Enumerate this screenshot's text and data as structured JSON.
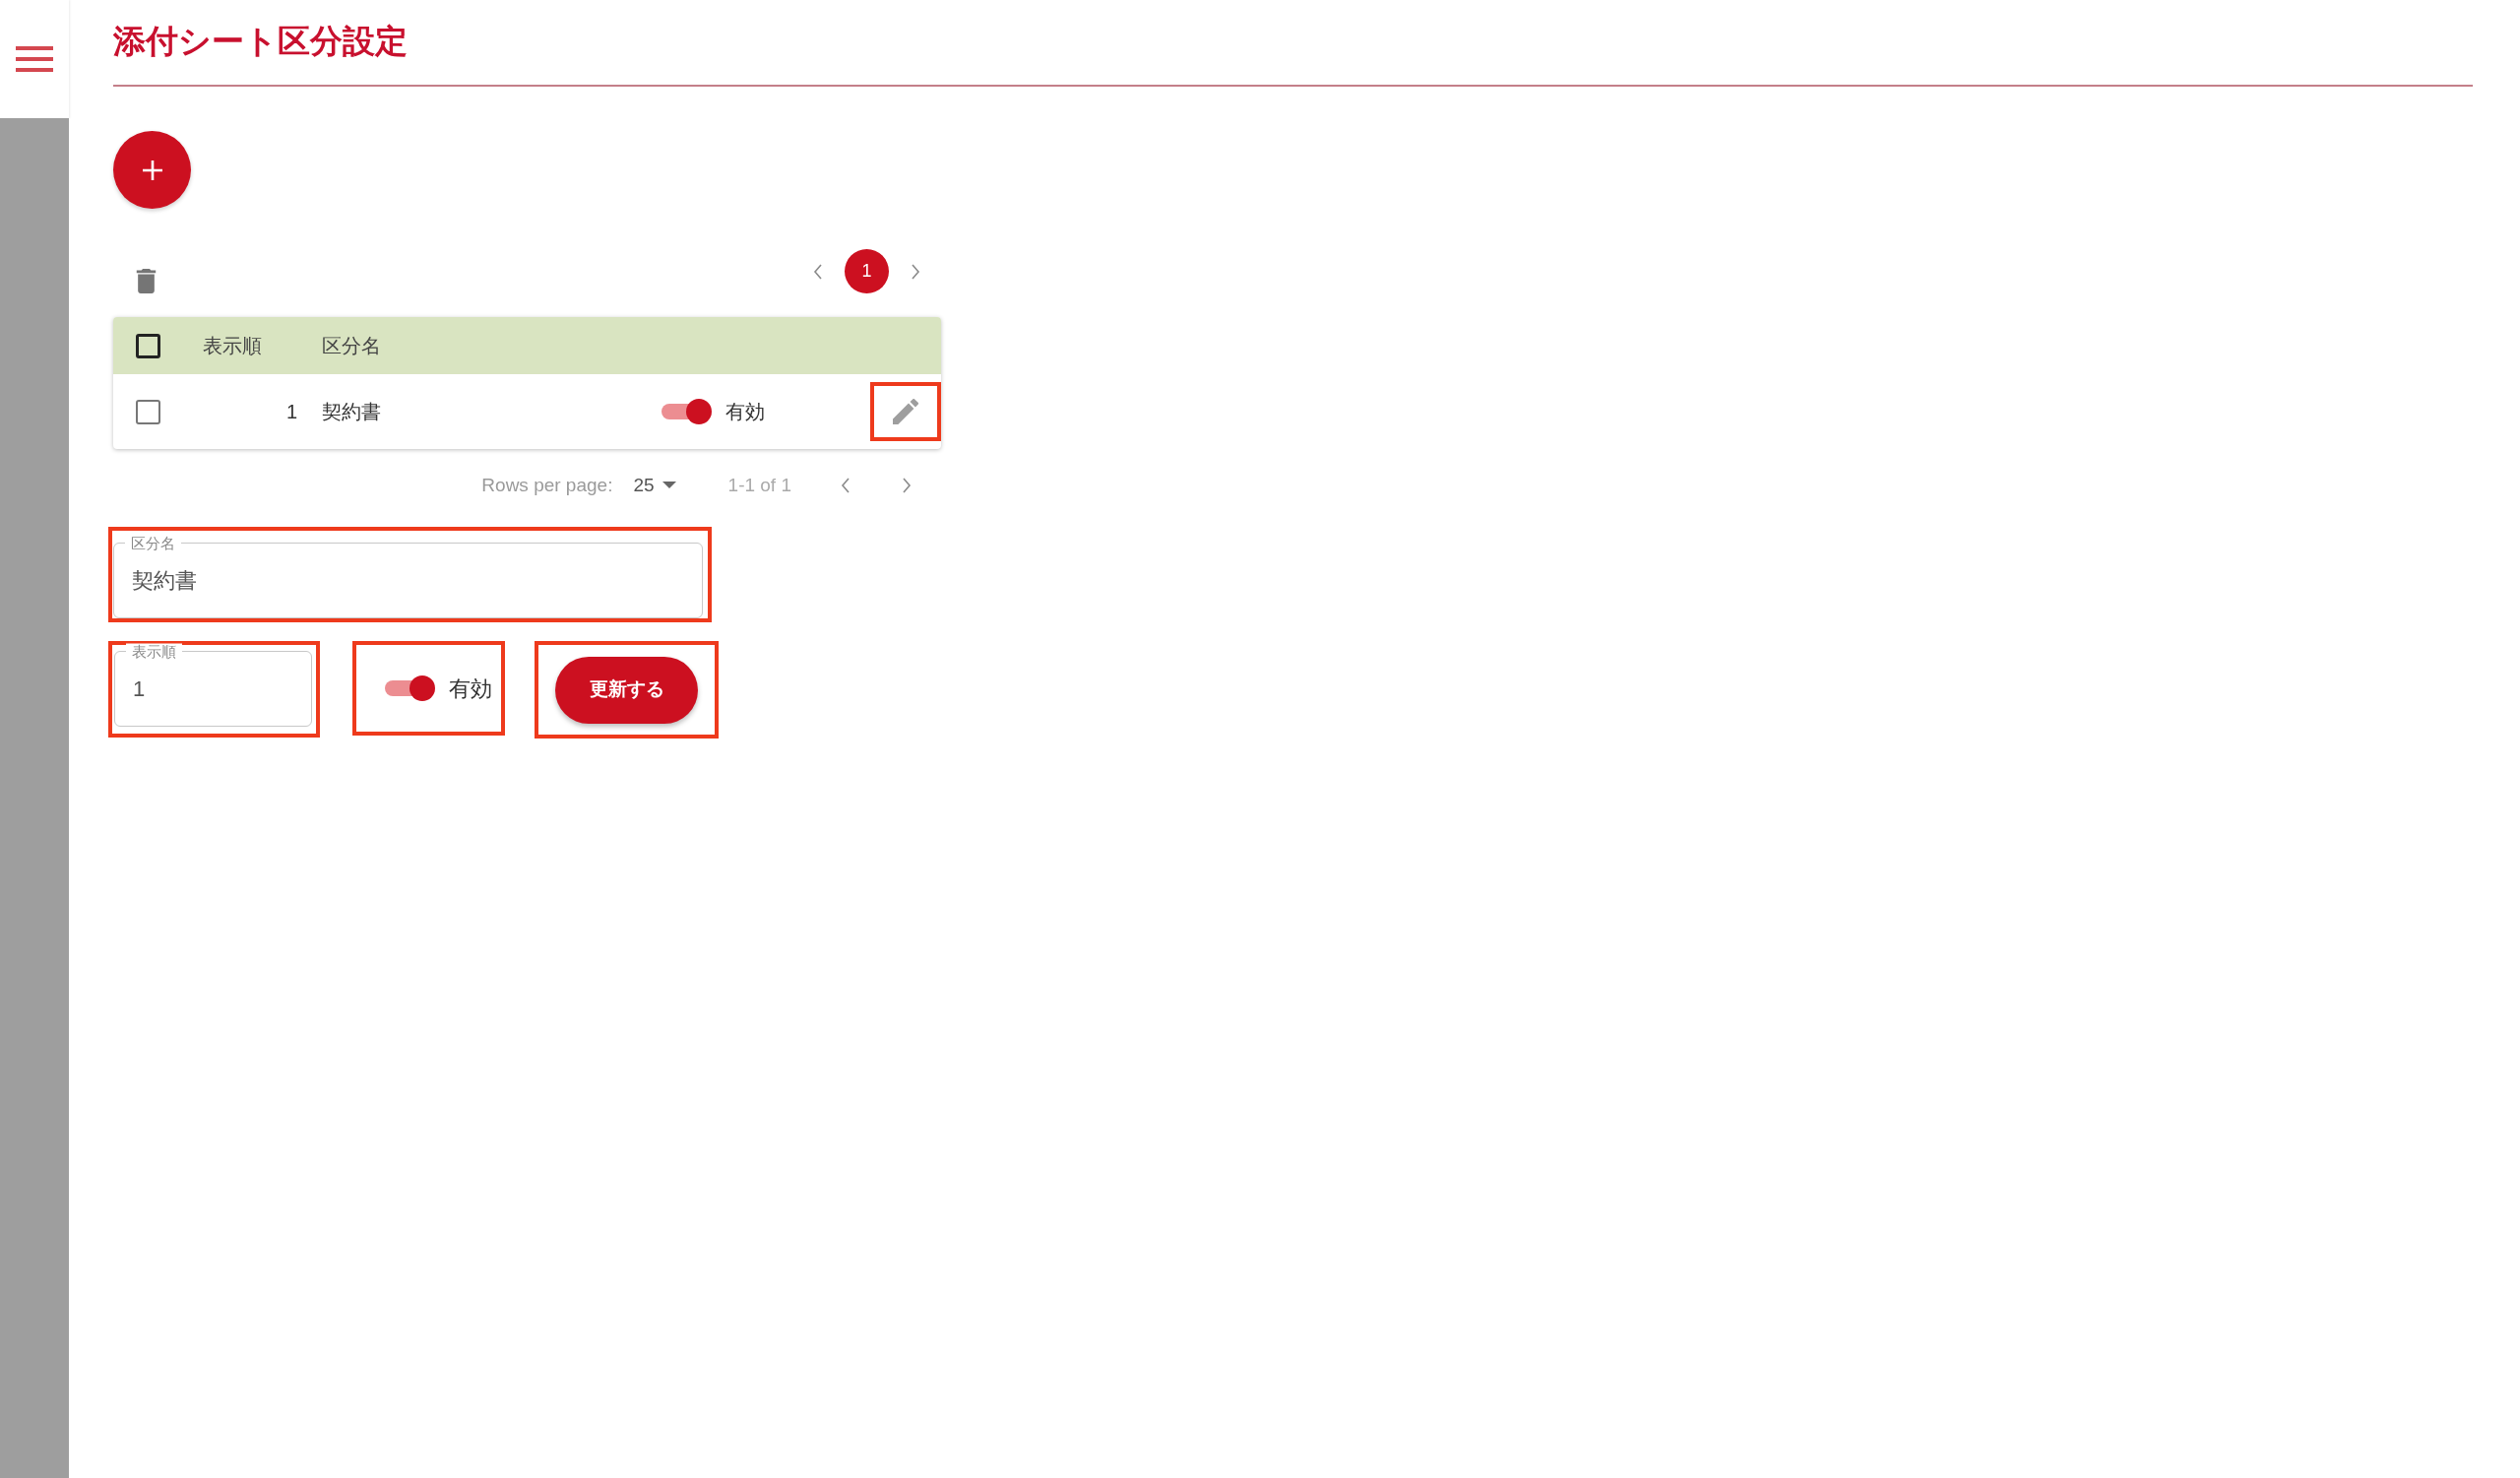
{
  "page": {
    "title": "添付シート区分設定"
  },
  "pagination": {
    "pages": [
      {
        "label": "1",
        "selected": true
      }
    ]
  },
  "table": {
    "header_checked": false,
    "columns": [
      "表示順",
      "区分名"
    ],
    "rows": [
      {
        "checked": false,
        "order": "1",
        "name": "契約書",
        "enabled": true,
        "status": "有効",
        "edit_highlighted": true
      }
    ],
    "footer": {
      "rows_per_page_label": "Rows per page:",
      "rows_per_page": "25",
      "range": "1-1 of 1"
    }
  },
  "form": {
    "name_field": {
      "label": "区分名",
      "value": "契約書",
      "highlighted": true
    },
    "order_field": {
      "label": "表示順",
      "value": "1",
      "highlighted": true
    },
    "enabled_switch": {
      "on": true,
      "label": "有効",
      "highlighted": true
    },
    "submit_button": {
      "label": "更新する",
      "highlighted": true
    }
  }
}
